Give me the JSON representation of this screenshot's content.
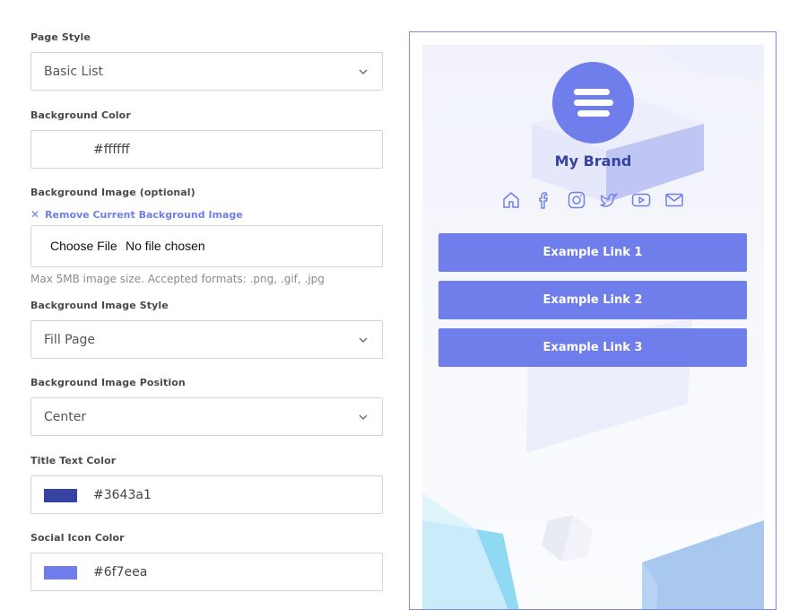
{
  "settings": {
    "page_style": {
      "label": "Page Style",
      "value": "Basic List"
    },
    "background_color": {
      "label": "Background Color",
      "value": "#ffffff",
      "swatch": "#ffffff"
    },
    "background_image": {
      "label": "Background Image (optional)",
      "remove_label": "Remove Current Background Image",
      "choose_button": "Choose File",
      "file_status": "No file chosen",
      "hint": "Max 5MB image size. Accepted formats: .png, .gif, .jpg"
    },
    "background_image_style": {
      "label": "Background Image Style",
      "value": "Fill Page"
    },
    "background_image_position": {
      "label": "Background Image Position",
      "value": "Center"
    },
    "title_text_color": {
      "label": "Title Text Color",
      "value": "#3643a1",
      "swatch": "#3643a1"
    },
    "social_icon_color": {
      "label": "Social Icon Color",
      "value": "#6f7eea",
      "swatch": "#6f7eea"
    }
  },
  "preview": {
    "brand_name": "My Brand",
    "accent_color": "#6f7eea",
    "title_color": "#3643a1",
    "social_icons": [
      "home-icon",
      "facebook-icon",
      "instagram-icon",
      "twitter-icon",
      "youtube-icon",
      "mail-icon"
    ],
    "links": [
      "Example Link 1",
      "Example Link 2",
      "Example Link 3"
    ]
  }
}
